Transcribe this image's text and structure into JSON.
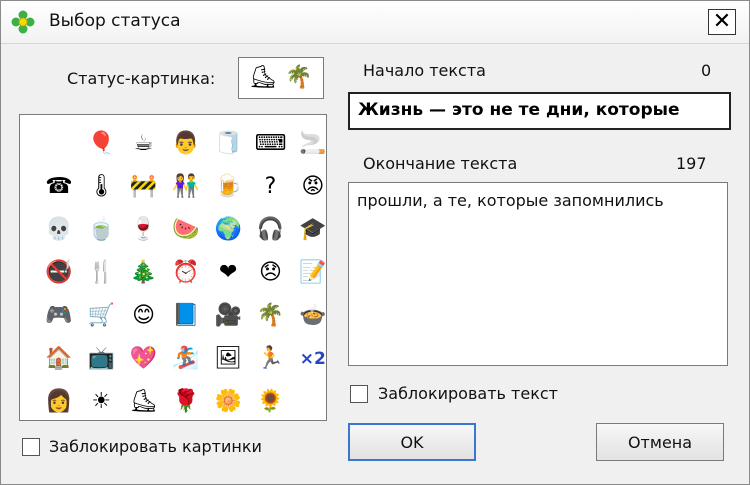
{
  "window": {
    "title": "Выбор статуса",
    "close_symbol": "✕"
  },
  "pictures": {
    "label": "Статус-картинка:",
    "selected": [
      {
        "name": "skater-icon",
        "glyph": "⛸"
      },
      {
        "name": "palm-icon",
        "glyph": "🌴"
      }
    ],
    "icons": [
      {
        "name": "empty-icon",
        "glyph": ""
      },
      {
        "name": "balloons-icon",
        "glyph": "🎈"
      },
      {
        "name": "coffee-cup-icon",
        "glyph": "☕"
      },
      {
        "name": "office-worker-icon",
        "glyph": "👨"
      },
      {
        "name": "toilet-paper-icon",
        "glyph": "🧻"
      },
      {
        "name": "typewriter-icon",
        "glyph": "⌨"
      },
      {
        "name": "cigarette-icon",
        "glyph": "🚬"
      },
      {
        "name": "phone-icon",
        "glyph": "☎"
      },
      {
        "name": "thermometer-icon",
        "glyph": "🌡"
      },
      {
        "name": "worker-sign-icon",
        "glyph": "🚧"
      },
      {
        "name": "couple-icon",
        "glyph": "👫"
      },
      {
        "name": "beer-icon",
        "glyph": "🍺"
      },
      {
        "name": "question-icon",
        "glyph": "?"
      },
      {
        "name": "angry-face-icon",
        "glyph": "😡"
      },
      {
        "name": "skull-icon",
        "glyph": "💀"
      },
      {
        "name": "tea-cup-icon",
        "glyph": "🍵"
      },
      {
        "name": "wine-glass-icon",
        "glyph": "🍷"
      },
      {
        "name": "watermelon-icon",
        "glyph": "🍉"
      },
      {
        "name": "globe-icon",
        "glyph": "🌍"
      },
      {
        "name": "headphones-icon",
        "glyph": "🎧"
      },
      {
        "name": "graduation-cap-icon",
        "glyph": "🎓"
      },
      {
        "name": "pipe-icon",
        "glyph": "🚭"
      },
      {
        "name": "fork-knife-icon",
        "glyph": "🍴"
      },
      {
        "name": "christmas-tree-icon",
        "glyph": "🎄"
      },
      {
        "name": "alarm-clock-icon",
        "glyph": "⏰"
      },
      {
        "name": "heart-icon",
        "glyph": "❤"
      },
      {
        "name": "sad-face-icon",
        "glyph": "😞"
      },
      {
        "name": "notebook-pencil-icon",
        "glyph": "📝"
      },
      {
        "name": "gamepad-icon",
        "glyph": "🎮"
      },
      {
        "name": "shopping-cart-icon",
        "glyph": "🛒"
      },
      {
        "name": "smiling-face-icon",
        "glyph": "😊"
      },
      {
        "name": "book-icon",
        "glyph": "📘"
      },
      {
        "name": "video-camera-icon",
        "glyph": "🎥"
      },
      {
        "name": "palm-tree-icon",
        "glyph": "🌴"
      },
      {
        "name": "pot-icon",
        "glyph": "🍲"
      },
      {
        "name": "house-icon",
        "glyph": "🏠"
      },
      {
        "name": "tv-icon",
        "glyph": "📺"
      },
      {
        "name": "love-heart-icon",
        "glyph": "💖"
      },
      {
        "name": "snowboard-icon",
        "glyph": "🏂"
      },
      {
        "name": "picture-icon",
        "glyph": "🖼"
      },
      {
        "name": "runner-icon",
        "glyph": "🏃"
      },
      {
        "name": "x2-icon",
        "glyph": "×2"
      },
      {
        "name": "woman-icon",
        "glyph": "👩"
      },
      {
        "name": "sun-icon",
        "glyph": "☀"
      },
      {
        "name": "ice-skater-icon",
        "glyph": "⛸"
      },
      {
        "name": "rose-icon",
        "glyph": "🌹"
      },
      {
        "name": "blue-flower-icon",
        "glyph": "🌼"
      },
      {
        "name": "orange-flower-icon",
        "glyph": "🌻"
      }
    ],
    "lock_label": "Заблокировать картинки"
  },
  "text": {
    "start_label": "Начало текста",
    "start_count": "0",
    "start_value": "Жизнь — это не те дни, которые",
    "end_label": "Окончание текста",
    "end_count": "197",
    "end_value": "прошли, а те, которые запомнились",
    "lock_label": "Заблокировать текст"
  },
  "buttons": {
    "ok": "OK",
    "cancel": "Отмена"
  },
  "colors": {
    "accent": "#3a76cf",
    "border": "#7a7a7a",
    "background": "#f0f0f0"
  }
}
